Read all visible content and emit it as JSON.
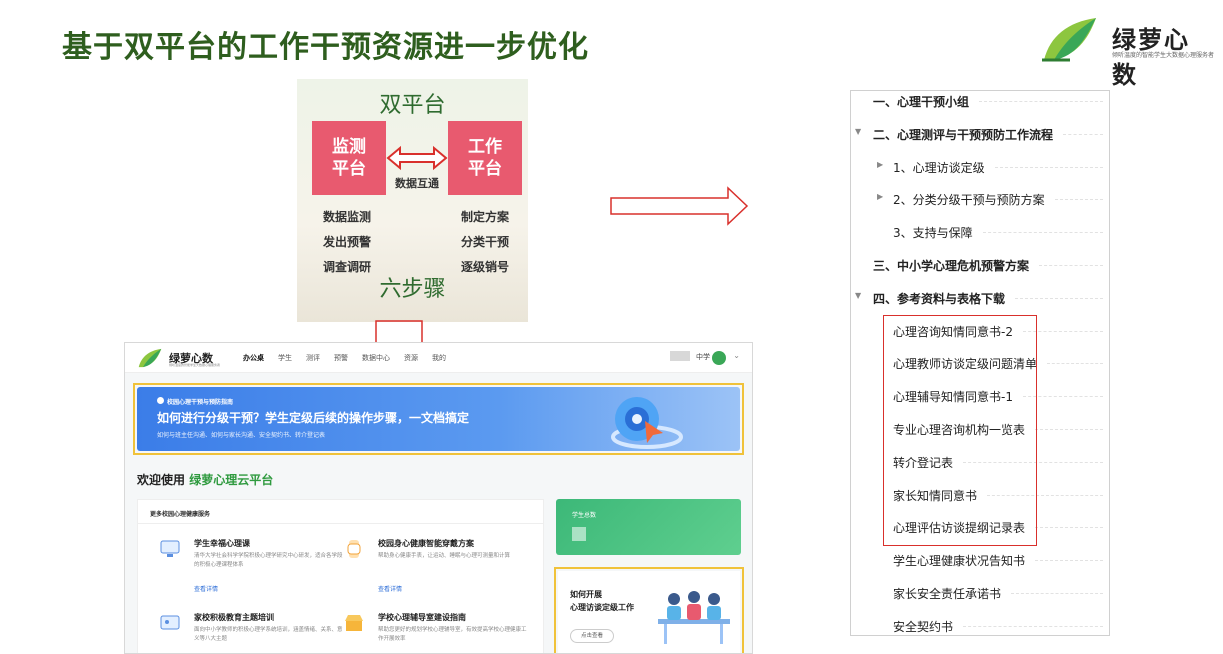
{
  "slide": {
    "title": "基于双平台的工作干预资源进一步优化"
  },
  "logo": {
    "brand": "绿萝心数",
    "slogan": "倾听温度的智能学生大数据心理服务者"
  },
  "diagram": {
    "title": "双平台",
    "left_box": [
      "监测",
      "平台"
    ],
    "right_box": [
      "工作",
      "平台"
    ],
    "middle": "数据互通",
    "left_steps": [
      "数据监测",
      "发出预警",
      "调查调研"
    ],
    "right_steps": [
      "制定方案",
      "分类干预",
      "逐级销号"
    ],
    "footer": "六步骤"
  },
  "screenshot": {
    "brand": "绿萝心数",
    "brand_sub": "倾听温度的智能学生大数据心理服务者",
    "nav_items": [
      "办公桌",
      "学生",
      "测评",
      "预警",
      "数据中心",
      "资源",
      "我的"
    ],
    "active_nav": "办公桌",
    "user_label": "中学",
    "banner": {
      "tag": "校园心理干预与预防指南",
      "title": "如何进行分级干预？学生定级后续的操作步骤，一文档搞定",
      "subtitle": "如何与班主任沟通、如何与家长沟通、安全契约书、转介登记表"
    },
    "welcome_prefix": "欢迎使用",
    "welcome_brand": "绿萝心理云平台",
    "services_header": "更多校园心理健康服务",
    "services": [
      {
        "title": "学生幸福心理课",
        "desc": "清华大学社会科学学院积极心理学研究中心研发，适合各学段的积极心理课程体系",
        "link": "查看详情"
      },
      {
        "title": "校园身心健康智能穿戴方案",
        "desc": "帮助身心健康手表，让运动、睡眠与心理可测量和计算",
        "link": "查看详情"
      },
      {
        "title": "家校积极教育主题培训",
        "desc": "面向中小学教师的积极心理学系统培训，涵盖情绪、关系、意义等八大主题",
        "link": ""
      },
      {
        "title": "学校心理辅导室建设指南",
        "desc": "帮助您更好的规划学校心理辅导室，有效提高学校心理健康工作开展效率",
        "link": ""
      }
    ],
    "stat_label": "学生总数",
    "promo": {
      "line1": "如何开展",
      "line2": "心理访谈定级工作",
      "button": "点击查看"
    }
  },
  "tree": {
    "items": [
      {
        "label": "一、心理干预小组",
        "level": 0,
        "bold": true,
        "toggle": ""
      },
      {
        "label": "二、心理测评与干预预防工作流程",
        "level": 0,
        "bold": true,
        "toggle": "▼"
      },
      {
        "label": "1、心理访谈定级",
        "level": 1,
        "bold": false,
        "toggle": "▶"
      },
      {
        "label": "2、分类分级干预与预防方案",
        "level": 1,
        "bold": false,
        "toggle": "▶"
      },
      {
        "label": "3、支持与保障",
        "level": 1,
        "bold": false,
        "toggle": ""
      },
      {
        "label": "三、中小学心理危机预警方案",
        "level": 0,
        "bold": true,
        "toggle": ""
      },
      {
        "label": "四、参考资料与表格下载",
        "level": 0,
        "bold": true,
        "toggle": "▼"
      },
      {
        "label": "心理咨询知情同意书-2",
        "level": 1,
        "bold": false,
        "toggle": ""
      },
      {
        "label": "心理教师访谈定级问题清单",
        "level": 1,
        "bold": false,
        "toggle": ""
      },
      {
        "label": "心理辅导知情同意书-1",
        "level": 1,
        "bold": false,
        "toggle": ""
      },
      {
        "label": "专业心理咨询机构一览表",
        "level": 1,
        "bold": false,
        "toggle": ""
      },
      {
        "label": "转介登记表",
        "level": 1,
        "bold": false,
        "toggle": ""
      },
      {
        "label": "家长知情同意书",
        "level": 1,
        "bold": false,
        "toggle": ""
      },
      {
        "label": "心理评估访谈提纲记录表",
        "level": 1,
        "bold": false,
        "toggle": ""
      },
      {
        "label": "学生心理健康状况告知书",
        "level": 1,
        "bold": false,
        "toggle": ""
      },
      {
        "label": "家长安全责任承诺书",
        "level": 1,
        "bold": false,
        "toggle": ""
      },
      {
        "label": "安全契约书",
        "level": 1,
        "bold": false,
        "toggle": ""
      }
    ]
  },
  "colors": {
    "title_green": "#2e5e1e",
    "box_red": "#e85a6f",
    "banner_blue": "#3b7de8",
    "highlight_yellow": "#f0c23a",
    "highlight_red": "#d9302c",
    "brand_green": "#2f9a3f"
  }
}
